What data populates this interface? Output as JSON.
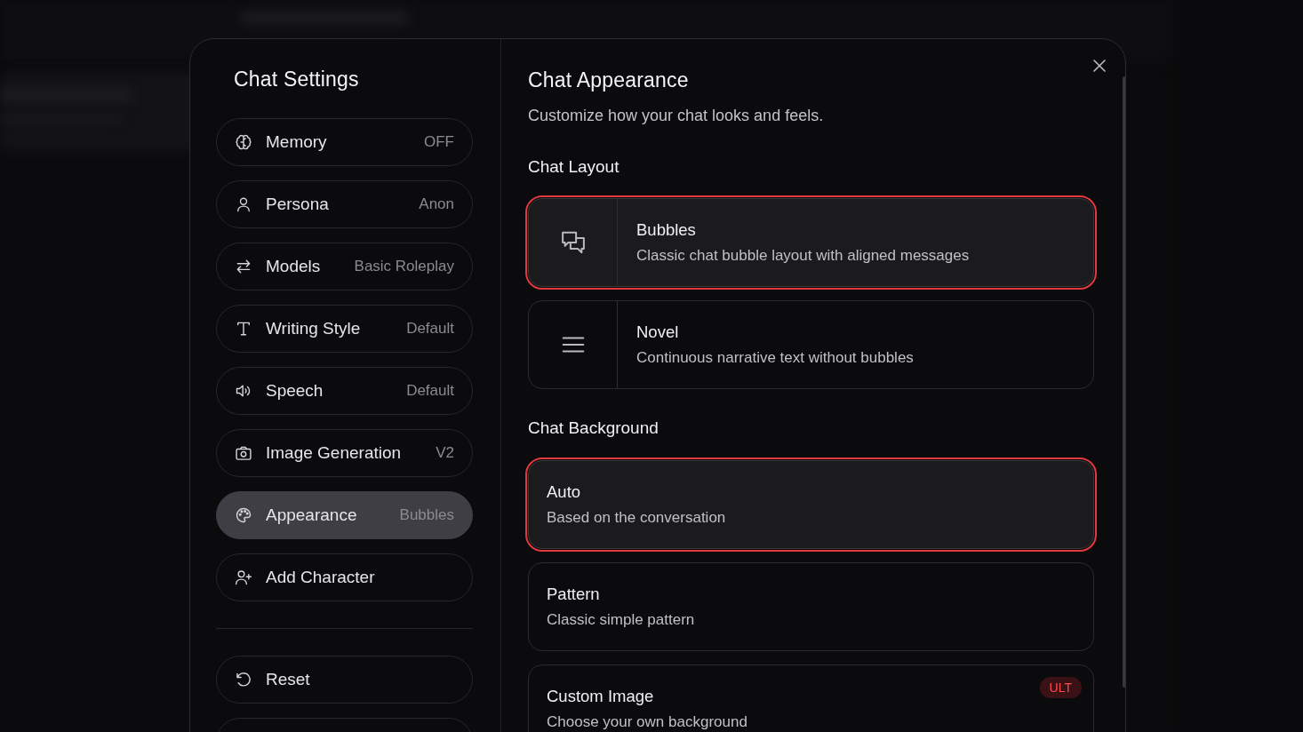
{
  "sidebar": {
    "title": "Chat Settings",
    "items": [
      {
        "label": "Memory",
        "value": "OFF",
        "selected": false
      },
      {
        "label": "Persona",
        "value": "Anon",
        "selected": false
      },
      {
        "label": "Models",
        "value": "Basic Roleplay",
        "selected": false
      },
      {
        "label": "Writing Style",
        "value": "Default",
        "selected": false
      },
      {
        "label": "Speech",
        "value": "Default",
        "selected": false
      },
      {
        "label": "Image Generation",
        "value": "V2",
        "selected": false
      },
      {
        "label": "Appearance",
        "value": "Bubbles",
        "selected": true
      },
      {
        "label": "Add Character",
        "selected": false
      }
    ],
    "footer_items": [
      {
        "label": "Reset"
      }
    ]
  },
  "panel": {
    "title": "Chat Appearance",
    "subtitle": "Customize how your chat looks and feels.",
    "sections": [
      {
        "heading": "Chat Layout",
        "kind": "icon_cards",
        "options": [
          {
            "title": "Bubbles",
            "description": "Classic chat bubble layout with aligned messages",
            "selected": true
          },
          {
            "title": "Novel",
            "description": "Continuous narrative text without bubbles",
            "selected": false
          }
        ]
      },
      {
        "heading": "Chat Background",
        "kind": "text_cards",
        "options": [
          {
            "title": "Auto",
            "description": "Based on the conversation",
            "selected": true
          },
          {
            "title": "Pattern",
            "description": "Classic simple pattern",
            "selected": false
          },
          {
            "title": "Custom Image",
            "description": "Choose your own background",
            "badge": "ULT",
            "selected": false
          }
        ]
      }
    ]
  }
}
